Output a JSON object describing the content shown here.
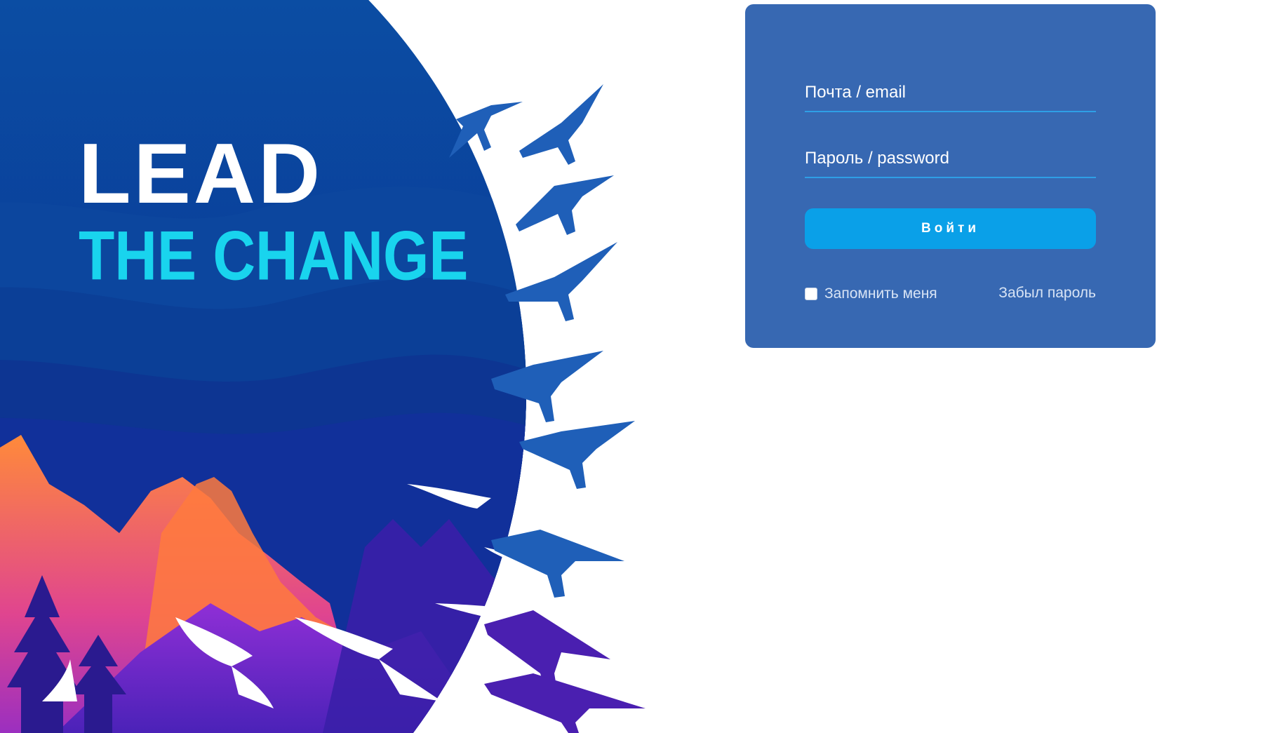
{
  "hero": {
    "headline_top": "LEAD",
    "headline_bottom": "THE CHANGE",
    "colors": {
      "circle_dark": "#0a3f8f",
      "circle_mid": "#154ea6",
      "headline_top": "#ffffff",
      "headline_bottom": "#19d4ee",
      "mountain_orange": "#ff7a3d",
      "mountain_purple": "#7e2bc8",
      "crane_blue": "#1f5fb8",
      "crane_violet": "#4a1fb0"
    }
  },
  "login": {
    "email_placeholder": "Почта / email",
    "password_placeholder": "Пароль / password",
    "submit_label": "Войти",
    "remember_label": "Запомнить меня",
    "remember_checked": false,
    "forgot_label": "Забыл пароль",
    "colors": {
      "card": "#3768b2",
      "button": "#0aa0e8",
      "field_underline": "#2f9fe6"
    }
  }
}
